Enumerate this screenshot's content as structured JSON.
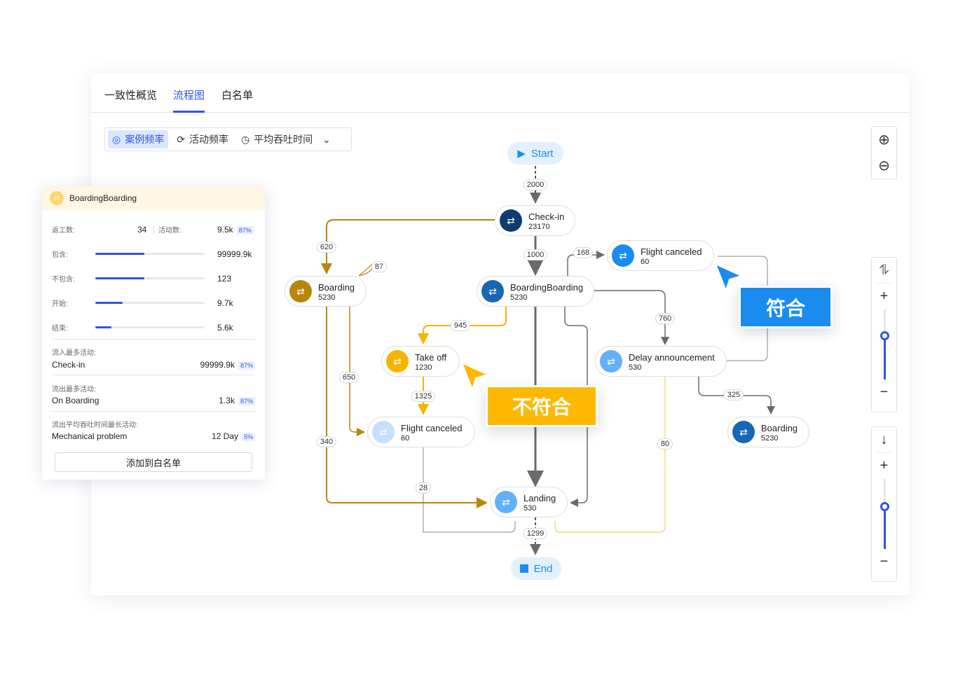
{
  "tabs": [
    {
      "label": "一致性概览"
    },
    {
      "label": "流程图"
    },
    {
      "label": "白名单"
    }
  ],
  "segments": [
    {
      "label": "案例频率",
      "icon": "frequency-icon"
    },
    {
      "label": "活动频率",
      "icon": "refresh-icon"
    },
    {
      "label": "平均吞吐时间",
      "icon": "clock-icon"
    }
  ],
  "colors": {
    "accent": "#2f54eb",
    "conform": "#1a8cf0",
    "nonconform": "#ffb800",
    "gold": "#b8860b",
    "gray": "#6b6b6b"
  },
  "sliders": {
    "zoom_level": 0.62,
    "detail_level": 0.6
  },
  "graph": {
    "start": "Start",
    "end": "End",
    "nodes": [
      {
        "name": "Check-in",
        "count": "23170"
      },
      {
        "name": "Flight canceled",
        "count": "60"
      },
      {
        "name": "Boarding",
        "count": "5230"
      },
      {
        "name": "BoardingBoarding",
        "count": "5230"
      },
      {
        "name": "Take off",
        "count": "1230"
      },
      {
        "name": "Delay announcement",
        "count": "530"
      },
      {
        "name": "Flight canceled",
        "count": "60"
      },
      {
        "name": "Boarding",
        "count": "5230"
      },
      {
        "name": "Landing",
        "count": "530"
      }
    ],
    "edges": [
      "2000",
      "1000",
      "620",
      "87",
      "168",
      "760",
      "945",
      "650",
      "1325",
      "340",
      "28",
      "325",
      "80",
      "1299"
    ]
  },
  "callouts": {
    "conform": "符合",
    "nonconform": "不符合"
  },
  "panel": {
    "title": "BoardingBoarding",
    "rework_label": "返工数:",
    "rework_value": "34",
    "activity_label": "活动数:",
    "activity_value": "9.5k",
    "activity_pct": "87%",
    "bars": [
      {
        "label": "包含:",
        "value": "99999.9k",
        "fraction": 0.45
      },
      {
        "label": "不包含:",
        "value": "123",
        "fraction": 0.45
      },
      {
        "label": "开始:",
        "value": "9.7k",
        "fraction": 0.25
      },
      {
        "label": "结束:",
        "value": "5.6k",
        "fraction": 0.15
      }
    ],
    "sections": [
      {
        "label": "流入最多活动:",
        "name": "Check-in",
        "value": "99999.9k",
        "pct": "87%"
      },
      {
        "label": "流出最多活动:",
        "name": "On Boarding",
        "value": "1.3k",
        "pct": "87%"
      },
      {
        "label": "流出平均吞吐时间最长活动:",
        "name": "Mechanical problem",
        "value": "12 Day",
        "pct": "5%"
      }
    ],
    "add_button": "添加到白名单"
  }
}
